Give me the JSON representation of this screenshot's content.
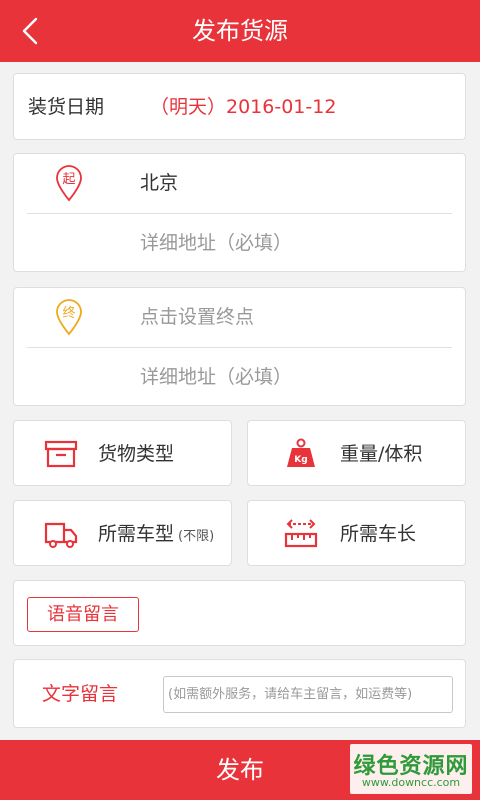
{
  "header": {
    "title": "发布货源",
    "back_icon": "chevron-left-icon"
  },
  "loading_date": {
    "label": "装货日期",
    "value": "（明天）2016-01-12"
  },
  "start": {
    "pin_char": "起",
    "city": "北京",
    "detail_placeholder": "详细地址（必填）"
  },
  "end": {
    "pin_char": "终",
    "city_placeholder": "点击设置终点",
    "detail_placeholder": "详细地址（必填）"
  },
  "options": {
    "cargo_type": "货物类型",
    "weight_volume": "重量/体积",
    "weight_icon_text": "Kg",
    "truck_type": "所需车型",
    "truck_type_note": "(不限)",
    "truck_length": "所需车长"
  },
  "voice": {
    "button_label": "语音留言"
  },
  "text_msg": {
    "label": "文字留言",
    "placeholder": "(如需额外服务，请给车主留言，如运费等)"
  },
  "publish_label": "发布",
  "watermark": {
    "main": "绿色资源网",
    "sub": "www.downcc.com"
  },
  "colors": {
    "accent": "#e8333a",
    "start_pin": "#e8333a",
    "end_pin": "#f0a91e",
    "watermark": "#2f9a39"
  }
}
